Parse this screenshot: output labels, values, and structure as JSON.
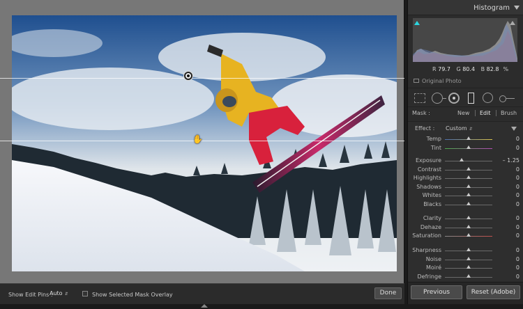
{
  "viewer": {
    "photo_alt": "snowboarder-jumping-photo"
  },
  "toolbar": {
    "show_edit_pins_label": "Show Edit Pins :",
    "show_edit_pins_value": "Auto",
    "show_mask_overlay_label": "Show Selected Mask Overlay",
    "done_label": "Done"
  },
  "panel": {
    "histogram_title": "Histogram",
    "readout": {
      "r_label": "R",
      "r_value": "79.7",
      "g_label": "G",
      "g_value": "80.4",
      "b_label": "B",
      "b_value": "82.8",
      "unit": "%"
    },
    "original_photo_label": "Original Photo",
    "mask": {
      "label": "Mask :",
      "new": "New",
      "edit": "Edit",
      "brush": "Brush"
    },
    "effect": {
      "label": "Effect :",
      "value": "Custom"
    },
    "sliders": [
      {
        "label": "Temp",
        "value": "0",
        "pos": 0.5,
        "group": 0,
        "track": "temp"
      },
      {
        "label": "Tint",
        "value": "0",
        "pos": 0.5,
        "group": 0,
        "track": "tint"
      },
      {
        "label": "Exposure",
        "value": "– 1.25",
        "pos": 0.36,
        "group": 1,
        "track": "plain"
      },
      {
        "label": "Contrast",
        "value": "0",
        "pos": 0.5,
        "group": 1,
        "track": "plain"
      },
      {
        "label": "Highlights",
        "value": "0",
        "pos": 0.5,
        "group": 1,
        "track": "plain"
      },
      {
        "label": "Shadows",
        "value": "0",
        "pos": 0.5,
        "group": 1,
        "track": "plain"
      },
      {
        "label": "Whites",
        "value": "0",
        "pos": 0.5,
        "group": 1,
        "track": "plain"
      },
      {
        "label": "Blacks",
        "value": "0",
        "pos": 0.5,
        "group": 1,
        "track": "plain"
      },
      {
        "label": "Clarity",
        "value": "0",
        "pos": 0.5,
        "group": 2,
        "track": "plain"
      },
      {
        "label": "Dehaze",
        "value": "0",
        "pos": 0.5,
        "group": 2,
        "track": "plain"
      },
      {
        "label": "Saturation",
        "value": "0",
        "pos": 0.5,
        "group": 2,
        "track": "sat"
      },
      {
        "label": "Sharpness",
        "value": "0",
        "pos": 0.5,
        "group": 3,
        "track": "plain"
      },
      {
        "label": "Noise",
        "value": "0",
        "pos": 0.5,
        "group": 3,
        "track": "plain"
      },
      {
        "label": "Moiré",
        "value": "0",
        "pos": 0.5,
        "group": 3,
        "track": "plain"
      },
      {
        "label": "Defringe",
        "value": "0",
        "pos": 0.5,
        "group": 3,
        "track": "plain"
      }
    ],
    "previous_label": "Previous",
    "reset_label": "Reset (Adobe)"
  },
  "colors": {
    "clip_shadow_indicator": "#2cd6e0",
    "jacket": "#e7b321",
    "pants": "#d8213c",
    "board": "#c92a6a"
  }
}
